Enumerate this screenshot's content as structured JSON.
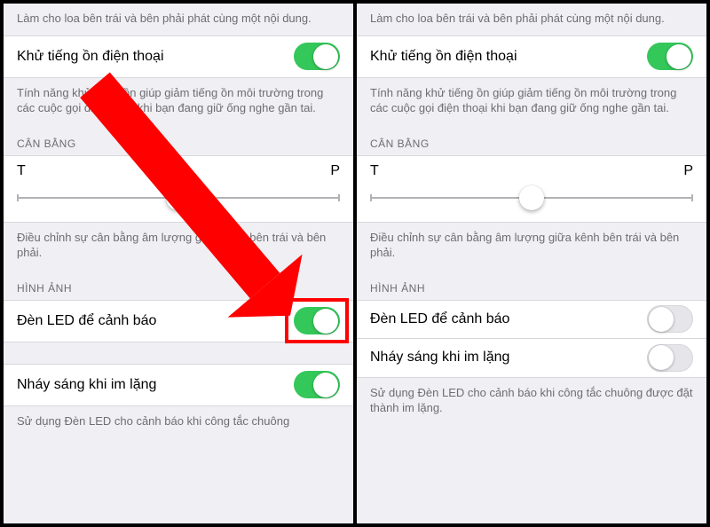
{
  "colors": {
    "switch_on": "#34c759",
    "arrow": "#ff0000",
    "highlight": "#ff0000",
    "bg": "#efeff4"
  },
  "left": {
    "mono_footer": "Làm cho loa bên trái và bên phải phát cùng một nội dung.",
    "noise_label": "Khử tiếng ồn điện thoại",
    "noise_on": true,
    "noise_footer": "Tính năng khử tiếng ồn giúp giảm tiếng ồn môi trường trong các cuộc gọi điện thoại khi bạn đang giữ ống nghe gần tai.",
    "balance_section": "CÂN BẰNG",
    "balance_left": "T",
    "balance_right": "P",
    "balance_value": 0.5,
    "balance_footer": "Điều chỉnh sự cân bằng âm lượng giữa kênh bên trái và bên phải.",
    "image_section": "HÌNH ẢNH",
    "led_label": "Đèn LED để cảnh báo",
    "led_on": true,
    "flash_label": "Nháy sáng khi im lặng",
    "flash_on": true,
    "led_footer_cut": "Sử dụng Đèn LED cho cảnh báo khi công tắc chuông"
  },
  "right": {
    "mono_footer": "Làm cho loa bên trái và bên phải phát cùng một nội dung.",
    "noise_label": "Khử tiếng ồn điện thoại",
    "noise_on": true,
    "noise_footer": "Tính năng khử tiếng ồn giúp giảm tiếng ồn môi trường trong các cuộc gọi điện thoại khi bạn đang giữ ống nghe gần tai.",
    "balance_section": "CÂN BẰNG",
    "balance_left": "T",
    "balance_right": "P",
    "balance_value": 0.5,
    "balance_footer": "Điều chỉnh sự cân bằng âm lượng giữa kênh bên trái và bên phải.",
    "image_section": "HÌNH ẢNH",
    "led_label": "Đèn LED để cảnh báo",
    "led_on": false,
    "flash_label": "Nháy sáng khi im lặng",
    "flash_on": false,
    "led_footer": "Sử dụng Đèn LED cho cảnh báo khi công tắc chuông được đặt thành im lặng."
  },
  "overlay": {
    "highlight_target": "left-led-switch"
  }
}
